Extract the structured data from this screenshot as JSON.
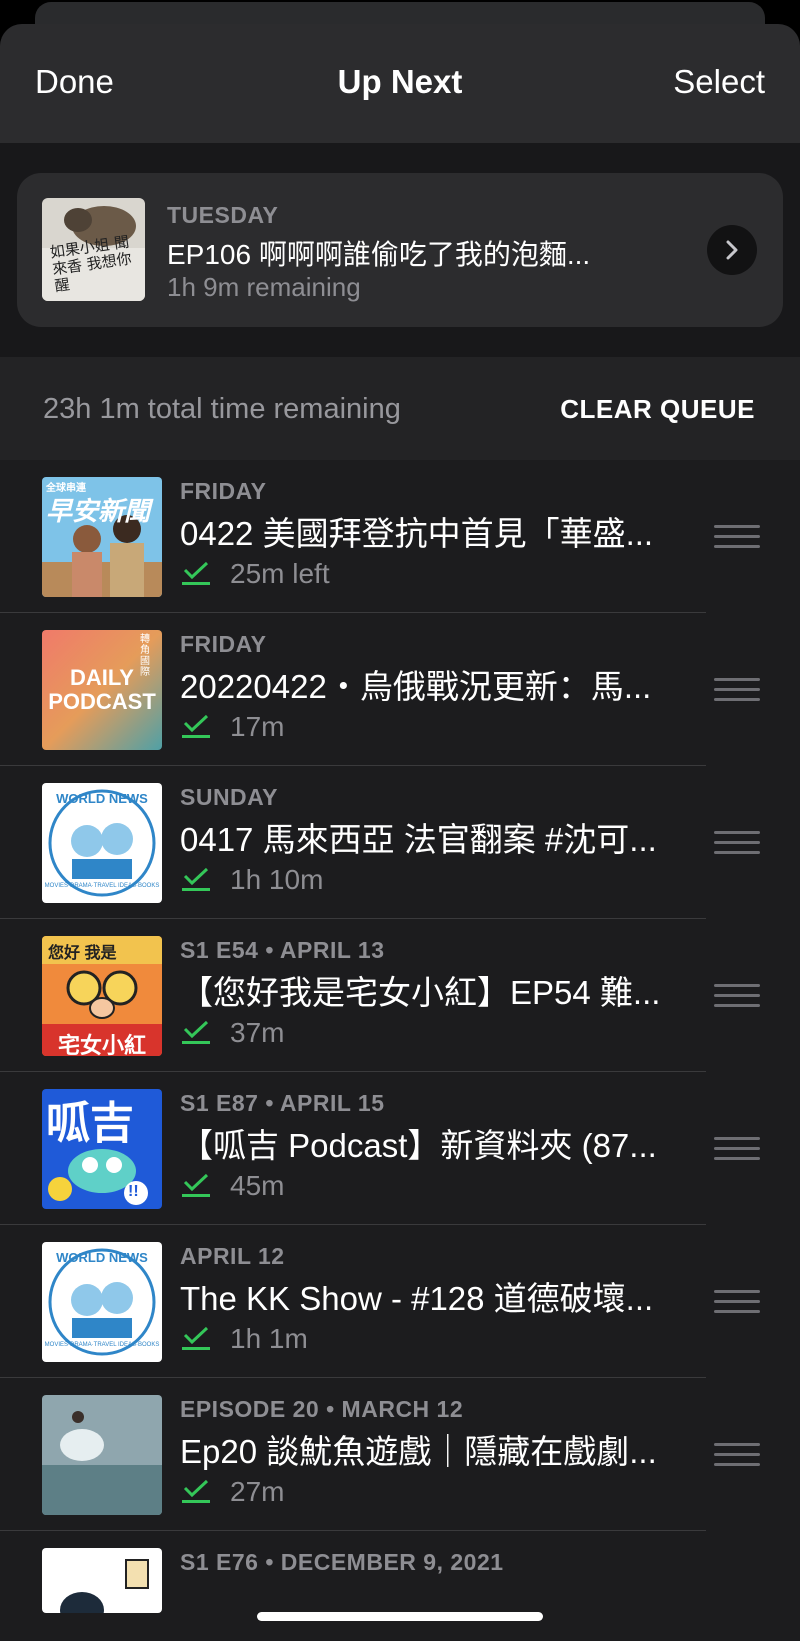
{
  "header": {
    "done_label": "Done",
    "title": "Up Next",
    "select_label": "Select"
  },
  "now_playing": {
    "day": "TUESDAY",
    "title": "EP106 啊啊啊誰偷吃了我的泡麵...",
    "remaining": "1h 9m remaining",
    "art_text": "如果小姐 聞來香 我想你醒"
  },
  "queue_summary": {
    "total_remaining": "23h 1m total time remaining",
    "clear_label": "CLEAR QUEUE"
  },
  "episodes": [
    {
      "meta": "FRIDAY",
      "title": "0422 美國拜登抗中首見「華盛...",
      "duration": "25m left",
      "art_text": "早安新聞",
      "art_sub": "全球串連"
    },
    {
      "meta": "FRIDAY",
      "title": "20220422・烏俄戰況更新：馬...",
      "duration": "17m",
      "art_text": "DAILY PODCAST",
      "art_sub": "轉角國際"
    },
    {
      "meta": "SUNDAY",
      "title": "0417 馬來西亞 法官翻案 #沈可...",
      "duration": "1h 10m",
      "art_text": "WORLD NEWS",
      "art_sub": "MOVIES·DRAMA·TRAVEL IDEAS·BOOKS"
    },
    {
      "meta": "S1 E54 • APRIL 13",
      "title": "【您好我是宅女小紅】EP54 難...",
      "duration": "37m",
      "art_text": "宅女小紅",
      "art_sub": "您好 我是"
    },
    {
      "meta": "S1 E87 • APRIL 15",
      "title": "【呱吉 Podcast】新資料夾 (87...",
      "duration": "45m",
      "art_text": "呱吉",
      "art_sub": "!!"
    },
    {
      "meta": "APRIL 12",
      "title": "The KK Show - #128 道德破壞...",
      "duration": "1h 1m",
      "art_text": "WORLD NEWS",
      "art_sub": "MOVIES·DRAMA·TRAVEL IDEAS·BOOKS"
    },
    {
      "meta": "EPISODE 20 • MARCH 12",
      "title": "Ep20 談魷魚遊戲｜隱藏在戲劇...",
      "duration": "27m",
      "art_text": "",
      "art_sub": ""
    },
    {
      "meta": "S1 E76 • DECEMBER 9, 2021",
      "title": "",
      "duration": "",
      "art_text": "",
      "art_sub": ""
    }
  ],
  "colors": {
    "accent_green": "#34c759",
    "background": "#1c1c1e",
    "secondary_text": "#8e8e93"
  }
}
